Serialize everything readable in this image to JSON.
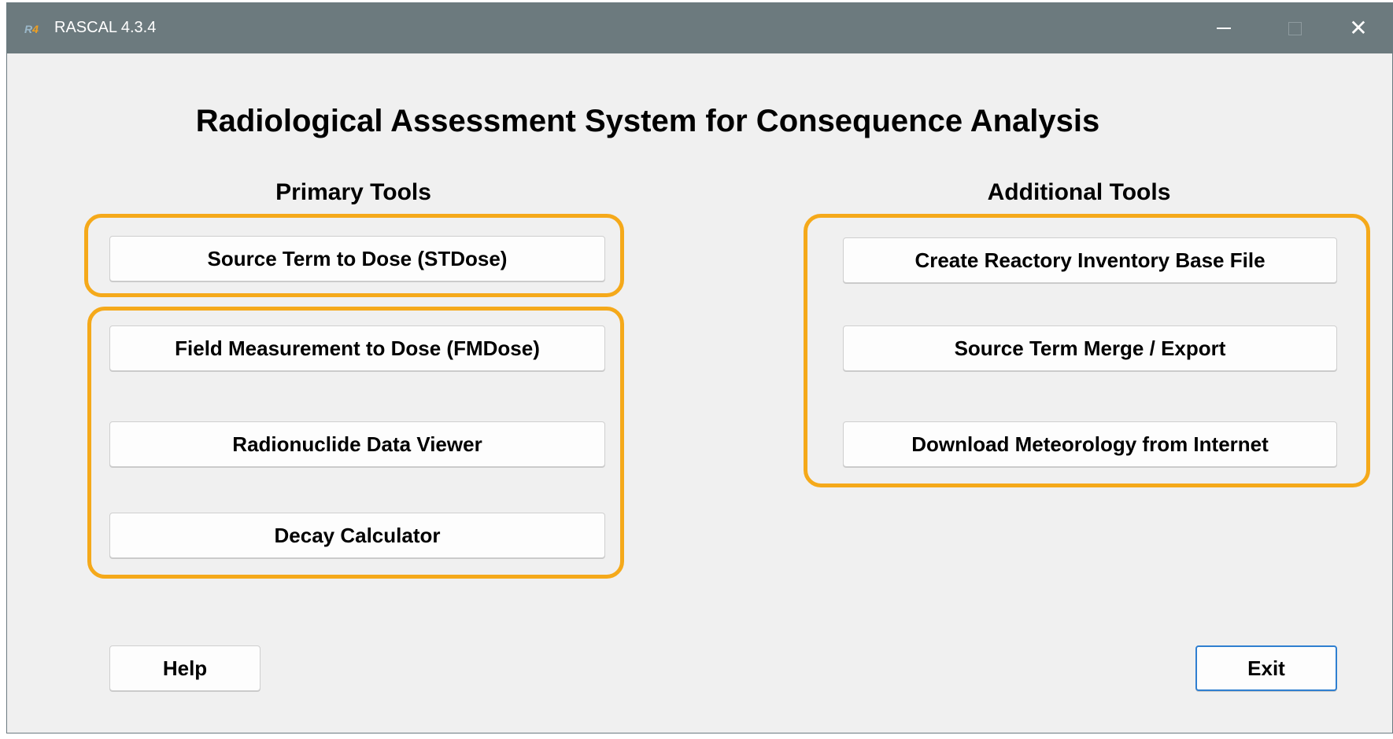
{
  "window": {
    "title": "RASCAL 4.3.4",
    "icon": "rascal-app-icon",
    "controls": [
      "minimize",
      "maximize",
      "close"
    ]
  },
  "main_title": "Radiological Assessment System for Consequence Analysis",
  "primary_tools": {
    "heading": "Primary Tools",
    "buttons": [
      "Source Term to Dose (STDose)",
      "Field Measurement to Dose (FMDose)",
      "Radionuclide Data Viewer",
      "Decay Calculator"
    ]
  },
  "additional_tools": {
    "heading": "Additional Tools",
    "buttons": [
      "Create Reactory Inventory Base File",
      "Source Term Merge / Export",
      "Download Meteorology from Internet"
    ]
  },
  "footer": {
    "help_label": "Help",
    "exit_label": "Exit"
  },
  "colors": {
    "highlight_outline": "#f5a91a",
    "titlebar": "#6c7a7e",
    "focus_border": "#2f7fd0"
  }
}
